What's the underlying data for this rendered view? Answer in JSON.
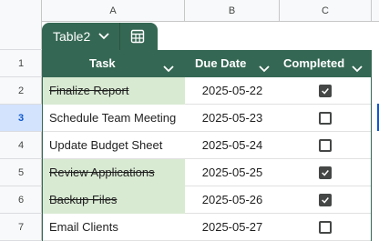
{
  "columns": [
    "A",
    "B",
    "C"
  ],
  "row_numbers": [
    "1",
    "2",
    "3",
    "4",
    "5",
    "6",
    "7"
  ],
  "selected_row": 3,
  "table_name": "Table2",
  "headers": {
    "task": "Task",
    "due_date": "Due Date",
    "completed": "Completed"
  },
  "rows": [
    {
      "task": "Finalize Report",
      "due": "2025-05-22",
      "completed": true
    },
    {
      "task": "Schedule Team Meeting",
      "due": "2025-05-23",
      "completed": false
    },
    {
      "task": "Update Budget Sheet",
      "due": "2025-05-24",
      "completed": false
    },
    {
      "task": "Review Applications",
      "due": "2025-05-25",
      "completed": true
    },
    {
      "task": "Backup Files",
      "due": "2025-05-26",
      "completed": true
    },
    {
      "task": "Email Clients",
      "due": "2025-05-27",
      "completed": false
    }
  ],
  "colors": {
    "table_header": "#356854",
    "completed_fill": "#d9ead3",
    "selection": "#0b57d0"
  },
  "icons": {
    "tab_menu": "chevron-down-icon",
    "table_view": "table-grid-icon",
    "column_menu": "chevron-down-icon",
    "checkbox_on": "checkbox-checked-icon",
    "checkbox_off": "checkbox-unchecked-icon"
  }
}
